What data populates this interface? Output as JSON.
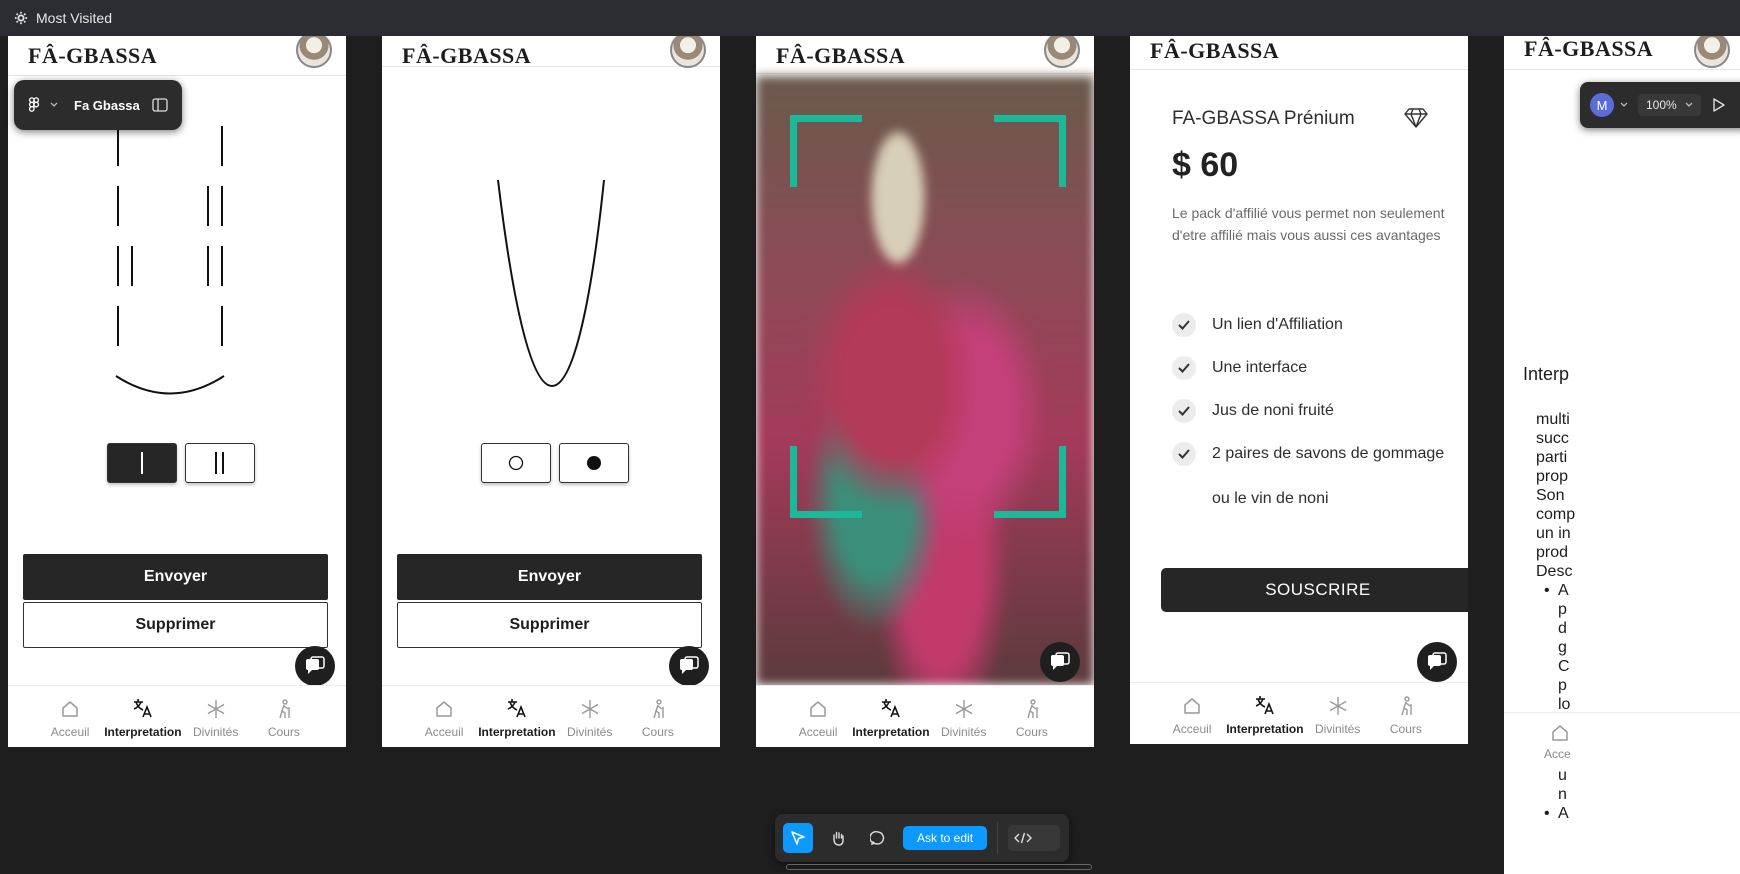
{
  "browser": {
    "bookmark_label": "Most Visited"
  },
  "figma": {
    "file_name": "Fa Gbassa",
    "zoom": "100%",
    "user_initial": "M",
    "ask_label": "Ask to edit"
  },
  "app": {
    "title": "FÂ-GBASSA",
    "title_partial": "FÂ-GBASSA",
    "nav": [
      "Acceuil",
      "Interpretation",
      "Divinités",
      "Cours"
    ],
    "nav_partial": "Acce",
    "send_label": "Envoyer",
    "delete_label": "Supprimer"
  },
  "premium": {
    "title": "FA-GBASSA Prénium",
    "price": "$ 60",
    "description": "Le pack d'affilié vous permet non seulement d'etre affilié mais vous aussi ces avantages",
    "features": [
      "Un lien d'Affiliation",
      "Une interface",
      "Jus de noni fruité",
      "2 paires de savons de gommage",
      "ou le vin de noni"
    ],
    "subscribe_label": "SOUSCRIRE"
  },
  "partial_frame": {
    "heading": "Interp",
    "lines": [
      "multi",
      "succ",
      "parti",
      "prop",
      "Son",
      "comp",
      "un in",
      "prod",
      "Desc"
    ],
    "bullet_lines": [
      "A",
      "p",
      "d",
      "g",
      "C",
      "p",
      "lo"
    ],
    "bottom_lines": [
      "u",
      "n"
    ],
    "bottom_bullet": "A"
  },
  "colors": {
    "accent": "#1bb89a",
    "figma_blue": "#0d99ff",
    "dark": "#262626"
  }
}
